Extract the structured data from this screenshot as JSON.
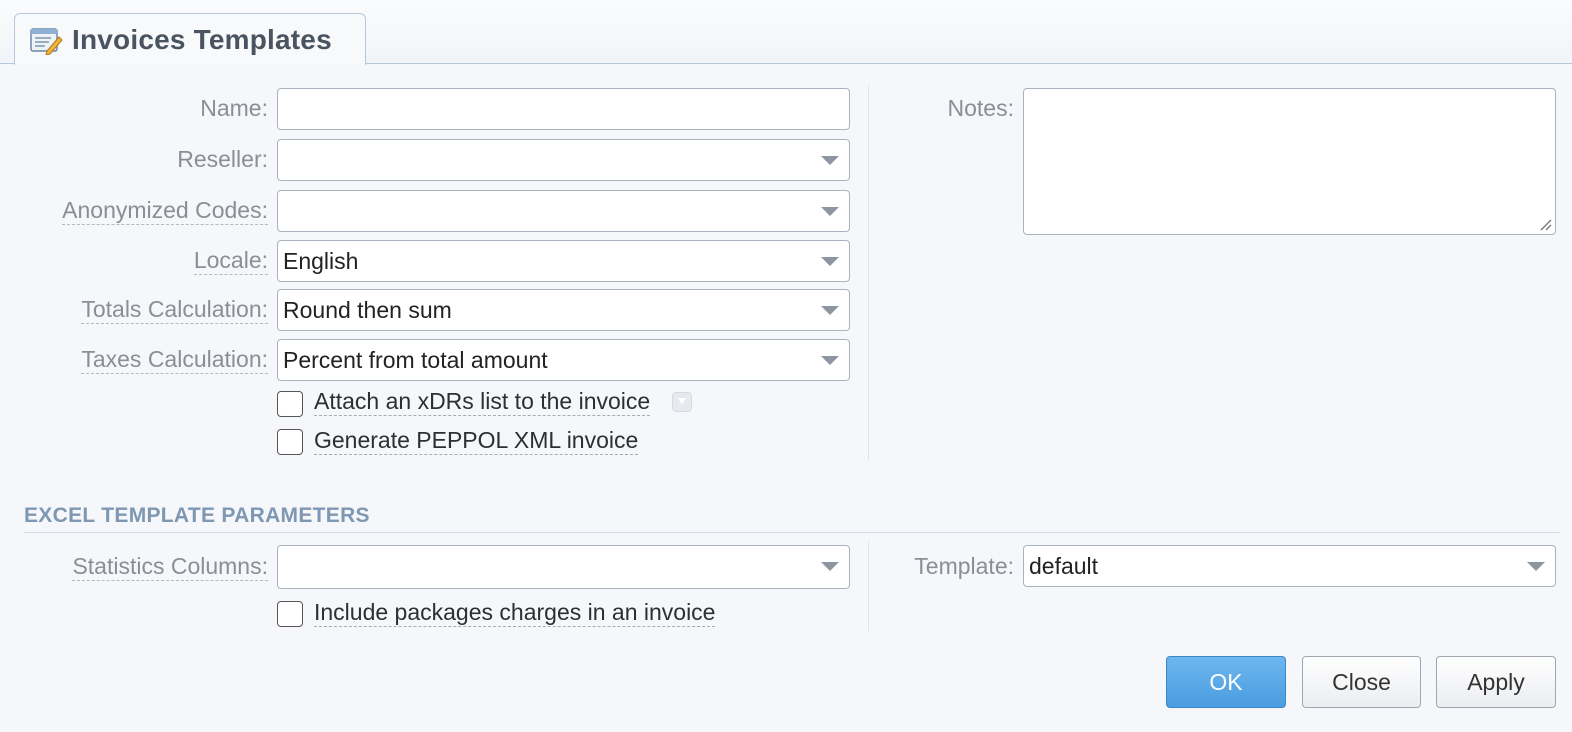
{
  "window": {
    "title": "Invoices Templates",
    "icon": "form-edit-icon"
  },
  "form": {
    "name": {
      "label": "Name:",
      "value": ""
    },
    "reseller": {
      "label": "Reseller:",
      "value": ""
    },
    "anonymized_codes": {
      "label": "Anonymized Codes:",
      "value": ""
    },
    "locale": {
      "label": "Locale:",
      "value": "English"
    },
    "totals_calculation": {
      "label": "Totals Calculation:",
      "value": "Round then sum"
    },
    "taxes_calculation": {
      "label": "Taxes Calculation:",
      "value": "Percent from total amount"
    },
    "attach_xdrs": {
      "label": "Attach an xDRs list to the invoice",
      "checked": false
    },
    "generate_peppol": {
      "label": "Generate PEPPOL XML invoice",
      "checked": false
    },
    "notes": {
      "label": "Notes:",
      "value": ""
    }
  },
  "excel": {
    "section_title": "EXCEL TEMPLATE PARAMETERS",
    "statistics_columns": {
      "label": "Statistics Columns:",
      "value": ""
    },
    "template": {
      "label": "Template:",
      "value": "default"
    },
    "include_packages": {
      "label": "Include packages charges in an invoice",
      "checked": false
    }
  },
  "buttons": {
    "ok": "OK",
    "close": "Close",
    "apply": "Apply"
  },
  "colors": {
    "accent": "#4a9de0",
    "section": "#7e97b2"
  }
}
